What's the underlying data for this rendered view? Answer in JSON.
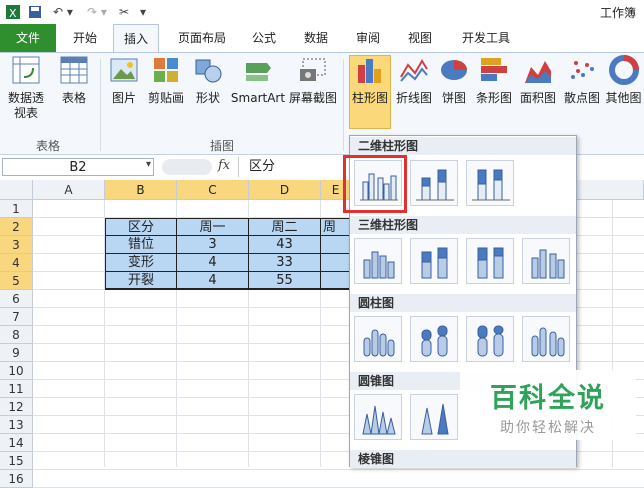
{
  "window": {
    "title": "工作簿"
  },
  "quick_access": {
    "save": "save-icon",
    "undo": "undo-icon",
    "redo": "redo-icon",
    "customize": "customize-icon"
  },
  "tabs": {
    "file": "文件",
    "home": "开始",
    "insert": "插入",
    "page_layout": "页面布局",
    "formulas": "公式",
    "data": "数据",
    "review": "审阅",
    "view": "视图",
    "developer": "开发工具"
  },
  "ribbon": {
    "pivot_table": "数据透视表",
    "table": "表格",
    "picture": "图片",
    "clip_art": "剪贴画",
    "shapes": "形状",
    "smartart": "SmartArt",
    "screenshot": "屏幕截图",
    "column_chart": "柱形图",
    "line_chart": "折线图",
    "pie_chart": "饼图",
    "bar_chart": "条形图",
    "area_chart": "面积图",
    "scatter_chart": "散点图",
    "other_chart": "其他图",
    "group_tables": "表格",
    "group_illustrations": "插图"
  },
  "formula_bar": {
    "name_box": "B2",
    "fx": "fx",
    "content": "区分"
  },
  "columns": [
    "A",
    "B",
    "C",
    "D",
    "E"
  ],
  "rows": [
    "1",
    "2",
    "3",
    "4",
    "5",
    "6",
    "7",
    "8",
    "9",
    "10",
    "11",
    "12",
    "13",
    "14",
    "15",
    "16"
  ],
  "table": {
    "header": [
      "区分",
      "周一",
      "周二",
      "周"
    ],
    "rows": [
      [
        "错位",
        "3",
        "43"
      ],
      [
        "变形",
        "4",
        "33"
      ],
      [
        "开裂",
        "4",
        "55"
      ]
    ]
  },
  "dropdown": {
    "sections": [
      "二维柱形图",
      "三维柱形图",
      "圆柱图",
      "圆锥图",
      "棱锥图"
    ]
  },
  "watermark": {
    "title": "百科全说",
    "subtitle": "助你轻松解决"
  },
  "colors": {
    "file_tab": "#2f8f2f",
    "selection": "#b9d6f2",
    "highlight": "#fbd97a",
    "red_box": "#e03030",
    "watermark": "#2fa35a"
  }
}
